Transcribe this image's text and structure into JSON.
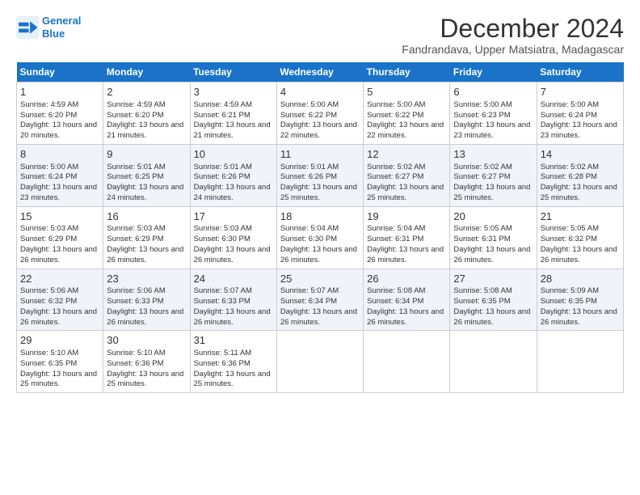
{
  "logo": {
    "line1": "General",
    "line2": "Blue"
  },
  "title": "December 2024",
  "location": "Fandrandava, Upper Matsiatra, Madagascar",
  "days_header": [
    "Sunday",
    "Monday",
    "Tuesday",
    "Wednesday",
    "Thursday",
    "Friday",
    "Saturday"
  ],
  "weeks": [
    [
      {
        "day": "1",
        "sunrise": "4:59 AM",
        "sunset": "6:20 PM",
        "daylight": "13 hours and 20 minutes."
      },
      {
        "day": "2",
        "sunrise": "4:59 AM",
        "sunset": "6:20 PM",
        "daylight": "13 hours and 21 minutes."
      },
      {
        "day": "3",
        "sunrise": "4:59 AM",
        "sunset": "6:21 PM",
        "daylight": "13 hours and 21 minutes."
      },
      {
        "day": "4",
        "sunrise": "5:00 AM",
        "sunset": "6:22 PM",
        "daylight": "13 hours and 22 minutes."
      },
      {
        "day": "5",
        "sunrise": "5:00 AM",
        "sunset": "6:22 PM",
        "daylight": "13 hours and 22 minutes."
      },
      {
        "day": "6",
        "sunrise": "5:00 AM",
        "sunset": "6:23 PM",
        "daylight": "13 hours and 23 minutes."
      },
      {
        "day": "7",
        "sunrise": "5:00 AM",
        "sunset": "6:24 PM",
        "daylight": "13 hours and 23 minutes."
      }
    ],
    [
      {
        "day": "8",
        "sunrise": "5:00 AM",
        "sunset": "6:24 PM",
        "daylight": "13 hours and 23 minutes."
      },
      {
        "day": "9",
        "sunrise": "5:01 AM",
        "sunset": "6:25 PM",
        "daylight": "13 hours and 24 minutes."
      },
      {
        "day": "10",
        "sunrise": "5:01 AM",
        "sunset": "6:26 PM",
        "daylight": "13 hours and 24 minutes."
      },
      {
        "day": "11",
        "sunrise": "5:01 AM",
        "sunset": "6:26 PM",
        "daylight": "13 hours and 25 minutes."
      },
      {
        "day": "12",
        "sunrise": "5:02 AM",
        "sunset": "6:27 PM",
        "daylight": "13 hours and 25 minutes."
      },
      {
        "day": "13",
        "sunrise": "5:02 AM",
        "sunset": "6:27 PM",
        "daylight": "13 hours and 25 minutes."
      },
      {
        "day": "14",
        "sunrise": "5:02 AM",
        "sunset": "6:28 PM",
        "daylight": "13 hours and 25 minutes."
      }
    ],
    [
      {
        "day": "15",
        "sunrise": "5:03 AM",
        "sunset": "6:29 PM",
        "daylight": "13 hours and 26 minutes."
      },
      {
        "day": "16",
        "sunrise": "5:03 AM",
        "sunset": "6:29 PM",
        "daylight": "13 hours and 26 minutes."
      },
      {
        "day": "17",
        "sunrise": "5:03 AM",
        "sunset": "6:30 PM",
        "daylight": "13 hours and 26 minutes."
      },
      {
        "day": "18",
        "sunrise": "5:04 AM",
        "sunset": "6:30 PM",
        "daylight": "13 hours and 26 minutes."
      },
      {
        "day": "19",
        "sunrise": "5:04 AM",
        "sunset": "6:31 PM",
        "daylight": "13 hours and 26 minutes."
      },
      {
        "day": "20",
        "sunrise": "5:05 AM",
        "sunset": "6:31 PM",
        "daylight": "13 hours and 26 minutes."
      },
      {
        "day": "21",
        "sunrise": "5:05 AM",
        "sunset": "6:32 PM",
        "daylight": "13 hours and 26 minutes."
      }
    ],
    [
      {
        "day": "22",
        "sunrise": "5:06 AM",
        "sunset": "6:32 PM",
        "daylight": "13 hours and 26 minutes."
      },
      {
        "day": "23",
        "sunrise": "5:06 AM",
        "sunset": "6:33 PM",
        "daylight": "13 hours and 26 minutes."
      },
      {
        "day": "24",
        "sunrise": "5:07 AM",
        "sunset": "6:33 PM",
        "daylight": "13 hours and 26 minutes."
      },
      {
        "day": "25",
        "sunrise": "5:07 AM",
        "sunset": "6:34 PM",
        "daylight": "13 hours and 26 minutes."
      },
      {
        "day": "26",
        "sunrise": "5:08 AM",
        "sunset": "6:34 PM",
        "daylight": "13 hours and 26 minutes."
      },
      {
        "day": "27",
        "sunrise": "5:08 AM",
        "sunset": "6:35 PM",
        "daylight": "13 hours and 26 minutes."
      },
      {
        "day": "28",
        "sunrise": "5:09 AM",
        "sunset": "6:35 PM",
        "daylight": "13 hours and 26 minutes."
      }
    ],
    [
      {
        "day": "29",
        "sunrise": "5:10 AM",
        "sunset": "6:35 PM",
        "daylight": "13 hours and 25 minutes."
      },
      {
        "day": "30",
        "sunrise": "5:10 AM",
        "sunset": "6:36 PM",
        "daylight": "13 hours and 25 minutes."
      },
      {
        "day": "31",
        "sunrise": "5:11 AM",
        "sunset": "6:36 PM",
        "daylight": "13 hours and 25 minutes."
      },
      null,
      null,
      null,
      null
    ]
  ]
}
